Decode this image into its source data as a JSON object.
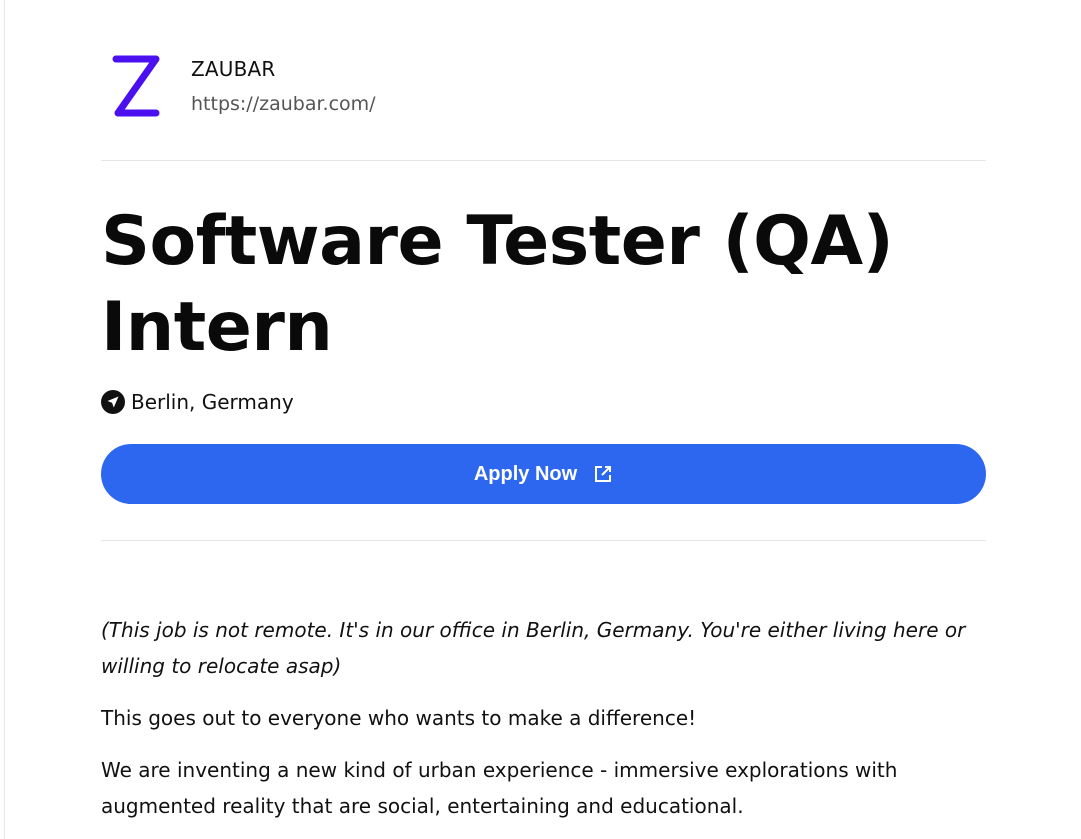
{
  "company": {
    "name": "ZAUBAR",
    "url": "https://zaubar.com/",
    "logo_icon": "zaubar-z-logo",
    "logo_color": "#4a10f0"
  },
  "job": {
    "title": "Software Tester (QA) Intern",
    "location": "Berlin, Germany",
    "location_icon": "navigation-arrow-icon"
  },
  "apply": {
    "label": "Apply Now",
    "icon": "external-link-icon",
    "color": "#2d67f0"
  },
  "description": {
    "paragraphs": [
      "(This job is not remote. It's in our office in Berlin, Germany. You're either living here or willing to relocate asap)",
      "This goes out to everyone who wants to make a difference!",
      "We are inventing a new kind of urban experience - immersive explorations with augmented reality that are social, entertaining and educational."
    ]
  }
}
